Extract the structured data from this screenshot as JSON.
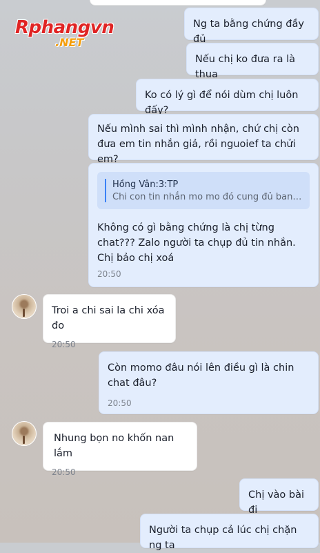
{
  "watermark": {
    "line1": "Rphangvn",
    "line2": ".NET"
  },
  "messages": [
    {
      "dir": "out",
      "text": "Ng ta bằng chứng đầy đủ"
    },
    {
      "dir": "out",
      "text": "Nếu chị ko đưa ra là thua"
    },
    {
      "dir": "out",
      "text": "Ko có lý gì để nói dùm chị luôn đấy?"
    },
    {
      "dir": "out",
      "text": "Nếu mình sai thì mình nhận, chứ chị còn đưa em tin nhắn giả, rồi nguoief ta chửi em?"
    },
    {
      "dir": "out",
      "quote_author": "Hồng Vân:3:TP",
      "quote_text": "Chi con tin nhắn mo mo đó cung đủ bang c...",
      "text": "Không có gì bằng chứng là chị từng chat??? Zalo người ta chụp đủ tin nhắn. Chị bảo chị xoá",
      "time": "20:50"
    },
    {
      "dir": "in",
      "text": "Troi a chi sai la chi xóa đo",
      "time": "20:50"
    },
    {
      "dir": "out",
      "text": "Còn momo đâu nói lên điều gì là chin chat đâu?",
      "time": "20:50"
    },
    {
      "dir": "in",
      "text": "Nhung bọn no khốn nan lắm",
      "time": "20:50"
    },
    {
      "dir": "out",
      "text": "Chị vào bài đi"
    },
    {
      "dir": "out",
      "text": "Người ta chụp cả lúc chị chặn ng ta"
    }
  ]
}
